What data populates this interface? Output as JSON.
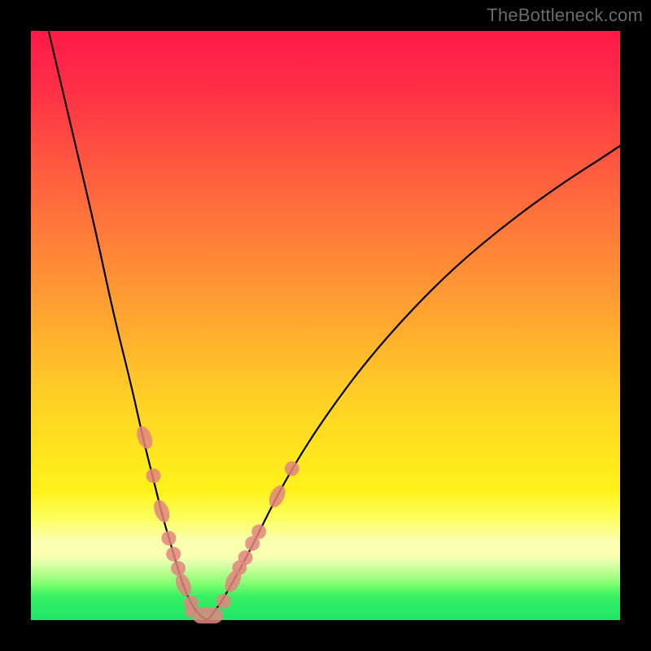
{
  "watermark": "TheBottleneck.com",
  "colors": {
    "background": "#000000",
    "gradient_top": "#ff1a49",
    "gradient_mid": "#ffe61e",
    "gradient_band": "#fbffb0",
    "gradient_bottom": "#1fe66a",
    "curve": "#000000",
    "marker": "#e2857e"
  },
  "chart_data": {
    "type": "line",
    "title": "",
    "xlabel": "",
    "ylabel": "",
    "xlim": [
      0,
      100
    ],
    "ylim": [
      0,
      100
    ],
    "series": [
      {
        "name": "left-curve",
        "x": [
          3,
          7,
          11,
          14,
          17,
          19,
          21,
          22.5,
          24,
          25,
          26,
          27,
          28,
          29,
          30
        ],
        "y": [
          100,
          83,
          66,
          52,
          40,
          31,
          23,
          17,
          12,
          8.5,
          5.5,
          3.2,
          1.6,
          0.5,
          0
        ]
      },
      {
        "name": "right-curve",
        "x": [
          30,
          32,
          34,
          36.5,
          39,
          42,
          46,
          51,
          57,
          64,
          72,
          81,
          90,
          97,
          100
        ],
        "y": [
          0,
          2.5,
          6,
          10.5,
          15.5,
          21.5,
          28.5,
          36,
          44,
          52,
          60,
          67.5,
          74,
          78.5,
          80.5
        ]
      }
    ],
    "markers_left": [
      {
        "x": 19.3,
        "y": 31.0,
        "kind": "pill"
      },
      {
        "x": 20.8,
        "y": 24.5
      },
      {
        "x": 22.2,
        "y": 18.5,
        "kind": "pill"
      },
      {
        "x": 23.4,
        "y": 13.9
      },
      {
        "x": 24.2,
        "y": 11.2
      },
      {
        "x": 25.0,
        "y": 8.8
      },
      {
        "x": 25.9,
        "y": 6.0,
        "kind": "pill"
      },
      {
        "x": 27.2,
        "y": 2.9
      }
    ],
    "markers_right": [
      {
        "x": 32.7,
        "y": 3.2
      },
      {
        "x": 34.3,
        "y": 6.6,
        "kind": "pill"
      },
      {
        "x": 35.4,
        "y": 8.9
      },
      {
        "x": 36.4,
        "y": 10.6
      },
      {
        "x": 37.6,
        "y": 13.0
      },
      {
        "x": 38.7,
        "y": 15.0
      },
      {
        "x": 41.8,
        "y": 21.0,
        "kind": "pill"
      },
      {
        "x": 44.3,
        "y": 25.7
      }
    ],
    "minimum_blob": {
      "x_start": 27.4,
      "x_end": 32.6,
      "y": 0.8
    }
  }
}
